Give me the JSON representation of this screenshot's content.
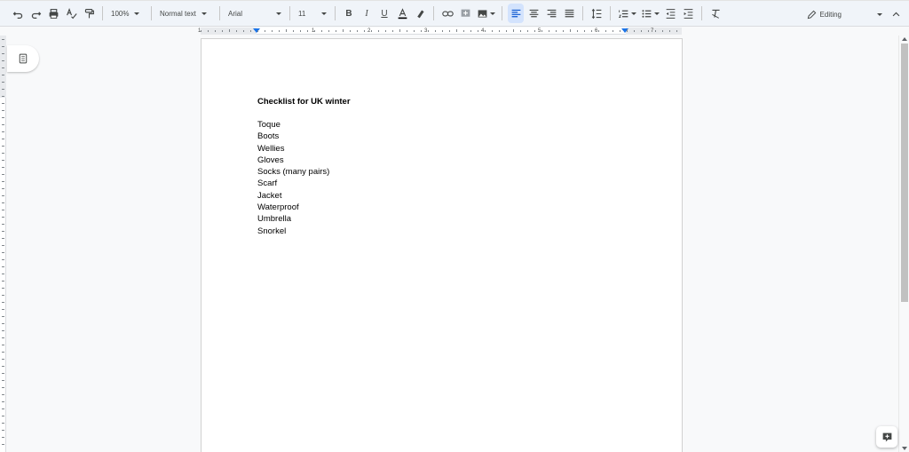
{
  "toolbar": {
    "zoom": "100%",
    "style": "Normal text",
    "font": "Arial",
    "font_size": "11",
    "mode": "Editing"
  },
  "ruler": {
    "numbers": [
      "1",
      "1",
      "2",
      "3",
      "4",
      "5",
      "6",
      "7"
    ]
  },
  "document": {
    "title": "Checklist for UK winter",
    "items": [
      "Toque",
      "Boots",
      "Wellies",
      "Gloves",
      "Socks (many pairs)",
      "Scarf",
      "Jacket",
      "Waterproof",
      "Umbrella",
      "Snorkel"
    ]
  },
  "colors": {
    "accent": "#1a73e8",
    "toolbar_bg": "#f0f4f9",
    "canvas_bg": "#f8f9fa"
  }
}
